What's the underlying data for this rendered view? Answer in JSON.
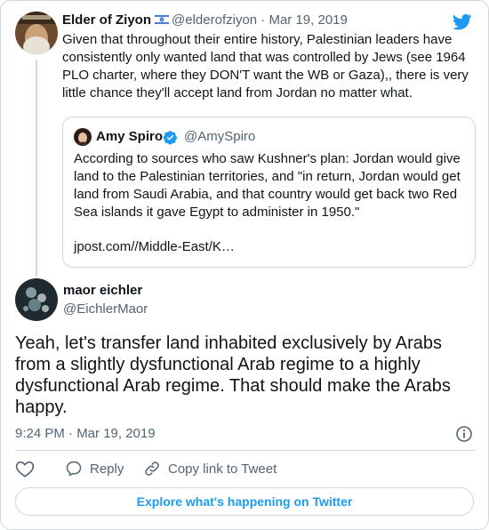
{
  "colors": {
    "brand": "#1d9bf0",
    "text": "#0f1419",
    "muted": "#536471",
    "border": "#cfd9de"
  },
  "parent_tweet": {
    "author_name": "Elder of Ziyon",
    "flag_icon": "israel-flag-icon",
    "handle": "@elderofziyon",
    "separator": "·",
    "date": "Mar 19, 2019",
    "text": "Given that throughout their entire history, Palestinian leaders have consistently only wanted land that was controlled by Jews (see 1964 PLO charter, where they DON'T want the WB or Gaza),, there is very little chance they'll accept land from Jordan no matter what.",
    "quoted": {
      "author_name": "Amy Spiro",
      "verified_icon": "verified-badge-icon",
      "handle": "@AmySpiro",
      "text": "According to sources who saw Kushner's plan: Jordan would give land to the Palestinian territories, and \"in return, Jordan would get land from Saudi Arabia, and that country would get back two Red Sea islands it gave Egypt to administer in 1950.\"",
      "link": "jpost.com//Middle-East/K…"
    }
  },
  "main_tweet": {
    "author_name": "maor eichler",
    "handle": "@EichlerMaor",
    "text": "Yeah, let's transfer land inhabited exclusively by Arabs from a slightly dysfunctional Arab regime to a highly dysfunctional Arab regime. That should make the Arabs happy.",
    "timestamp": "9:24 PM · Mar 19, 2019"
  },
  "actions": {
    "like_icon": "heart-icon",
    "reply_label": "Reply",
    "reply_icon": "reply-icon",
    "copy_label": "Copy link to Tweet",
    "copy_icon": "link-icon"
  },
  "footer": {
    "explore_label": "Explore what's happening on Twitter"
  },
  "icons": {
    "brand_icon": "twitter-bird-icon",
    "info_icon": "info-icon"
  }
}
